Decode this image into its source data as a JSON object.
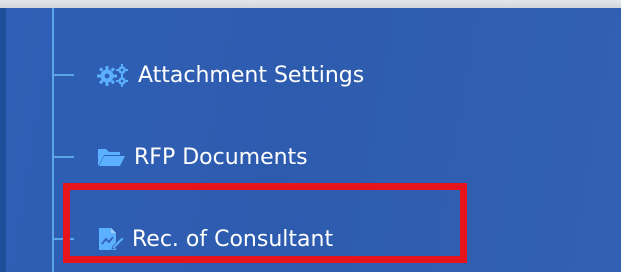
{
  "menu": {
    "items": [
      {
        "label": "Attachment Settings",
        "icon": "cogs-icon"
      },
      {
        "label": "RFP Documents",
        "icon": "folder-open-icon"
      },
      {
        "label": "Rec. of Consultant",
        "icon": "edit-document-icon"
      }
    ]
  },
  "colors": {
    "panel_background": "#2f5fb6",
    "tree_line": "#5aa6e6",
    "icon_blue": "#5bb0ff",
    "highlight_border": "#e8141b",
    "text": "#ffffff"
  }
}
